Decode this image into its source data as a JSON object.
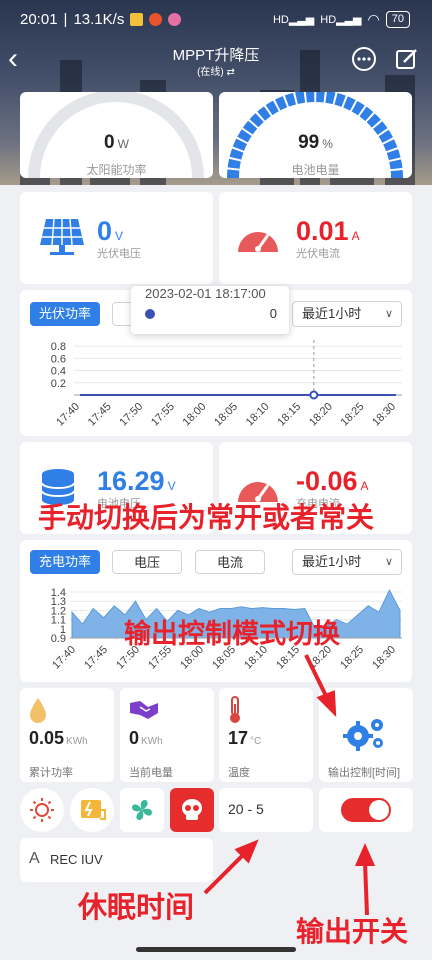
{
  "status_bar": {
    "time": "20:01",
    "speed": "13.1K/s",
    "signal1": "HD",
    "signal2": "HD",
    "battery": "70"
  },
  "nav": {
    "title": "MPPT升降压",
    "subtitle": "(在线) ⇄"
  },
  "gauges": [
    {
      "value": "0",
      "unit": "W",
      "caption": "太阳能功率",
      "fraction": 0
    },
    {
      "value": "99",
      "unit": "%",
      "caption": "电池电量",
      "fraction": 0.99
    }
  ],
  "pv": {
    "voltage": {
      "value": "0",
      "unit": "V",
      "caption": "光伏电压"
    },
    "current": {
      "value": "0.01",
      "unit": "A",
      "caption": "光伏电流"
    }
  },
  "chart1": {
    "tab_active": "光伏功率",
    "range_select": "最近1小时",
    "tooltip": {
      "time": "2023-02-01 18:17:00",
      "value": "0"
    },
    "chart_data": {
      "type": "line",
      "x": [
        "17:40",
        "17:45",
        "17:50",
        "17:55",
        "18:00",
        "18:05",
        "18:10",
        "18:15",
        "18:20",
        "18:25",
        "18:30"
      ],
      "y_ticks": [
        "0.8",
        "0.6",
        "0.4",
        "0.2"
      ],
      "ylim": [
        0,
        0.9
      ],
      "series": [
        {
          "values": [
            0,
            0,
            0,
            0,
            0,
            0,
            0,
            0,
            0,
            0,
            0
          ]
        }
      ],
      "highlight_x": "18:17"
    }
  },
  "battery": {
    "voltage": {
      "value": "16.29",
      "unit": "V",
      "caption": "电池电压"
    },
    "current": {
      "value": "-0.06",
      "unit": "A",
      "caption": "充电电流"
    }
  },
  "chart2": {
    "tabs": [
      "充电功率",
      "电压",
      "电流"
    ],
    "range_select": "最近1小时",
    "chart_data": {
      "type": "area",
      "x": [
        "17:40",
        "17:45",
        "17:50",
        "17:55",
        "18:00",
        "18:05",
        "18:10",
        "18:15",
        "18:20",
        "18:25",
        "18:30"
      ],
      "y_ticks": [
        "1.4",
        "1.3",
        "1.2",
        "1.1",
        "1",
        "0.9"
      ],
      "ylim": [
        0.9,
        1.4
      ],
      "series": [
        {
          "values": [
            1.18,
            1.05,
            1.22,
            1.12,
            1.25,
            1.15,
            1.3,
            1.1,
            1.22,
            1.08,
            1.2,
            1.15,
            1.22,
            1.18,
            1.22,
            1.22,
            1.24,
            1.22,
            1.23,
            1.22,
            1.22,
            1.21,
            1.22,
            1.0,
            1.02,
            1.1,
            1.05,
            1.15,
            1.25,
            1.18,
            1.42,
            1.2
          ]
        }
      ]
    }
  },
  "tiles": [
    {
      "value": "0.05",
      "unit": "KWh",
      "caption": "累计功率",
      "icon": "droplet-icon"
    },
    {
      "value": "0",
      "unit": "KWh",
      "caption": "当前电量",
      "icon": "handshake-icon"
    },
    {
      "value": "17",
      "unit": "°C",
      "caption": "温度",
      "icon": "thermometer-icon"
    },
    {
      "value": "",
      "unit": "",
      "caption": "输出控制[时间]",
      "icon": "gears-icon"
    }
  ],
  "controls": {
    "sleep_time": "20 - 5",
    "output_on": true,
    "rec": "REC IUV",
    "font_icon": "A"
  },
  "annotations": {
    "manual": "手动切换后为常开或者常关",
    "mode": "输出控制模式切换",
    "sleep": "休眠时间",
    "switch": "输出开关"
  },
  "colors": {
    "accent": "#2f7fe6",
    "danger": "#e8222a",
    "battery_blue": "#2f7fe6",
    "meter_red": "#e85a5a"
  }
}
